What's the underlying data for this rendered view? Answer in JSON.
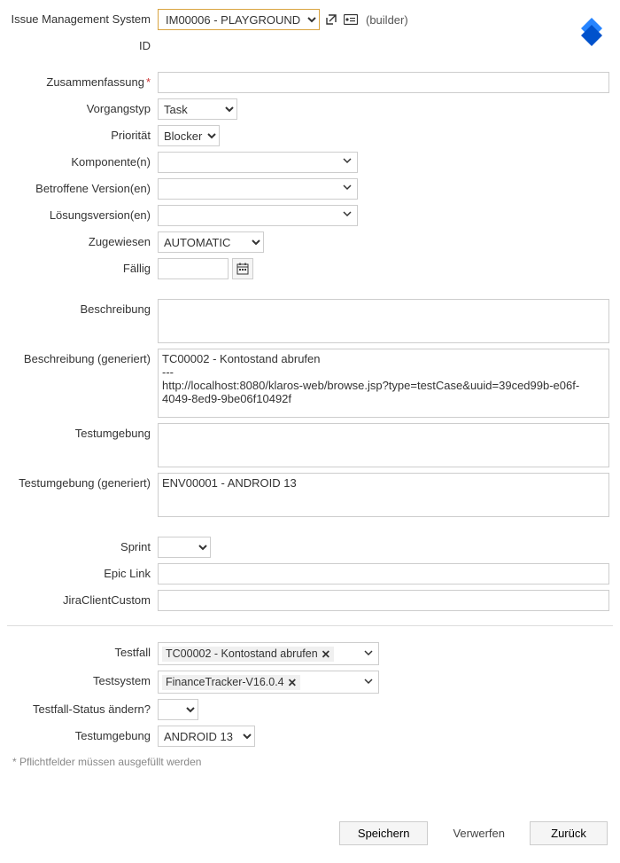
{
  "header": {
    "ims_label": "Issue Management System",
    "ims_value": "IM00006 - PLAYGROUND",
    "builder_note": "(builder)",
    "id_label": "ID"
  },
  "fields": {
    "summary_label": "Zusammenfassung",
    "issuetype_label": "Vorgangstyp",
    "issuetype_value": "Task",
    "priority_label": "Priorität",
    "priority_value": "Blocker",
    "components_label": "Komponente(n)",
    "affected_label": "Betroffene Version(en)",
    "fixversion_label": "Lösungsversion(en)",
    "assignee_label": "Zugewiesen",
    "assignee_value": "AUTOMATIC",
    "due_label": "Fällig",
    "description_label": "Beschreibung",
    "description_gen_label": "Beschreibung (generiert)",
    "description_gen_value": "TC00002 - Kontostand abrufen\n---\nhttp://localhost:8080/klaros-web/browse.jsp?type=testCase&uuid=39ced99b-e06f-4049-8ed9-9be06f10492f",
    "env_label": "Testumgebung",
    "env_gen_label": "Testumgebung (generiert)",
    "env_gen_value": "ENV00001 - ANDROID 13",
    "sprint_label": "Sprint",
    "epic_label": "Epic Link",
    "custom_label": "JiraClientCustom"
  },
  "bottom": {
    "testcase_label": "Testfall",
    "testcase_value": "TC00002 - Kontostand abrufen",
    "testsystem_label": "Testsystem",
    "testsystem_value": "FinanceTracker-V16.0.4",
    "status_label": "Testfall-Status ändern?",
    "env_label": "Testumgebung",
    "env_value": "ANDROID 13"
  },
  "footer": {
    "required_note": "* Pflichtfelder müssen ausgefüllt werden",
    "save": "Speichern",
    "discard": "Verwerfen",
    "back": "Zurück"
  }
}
